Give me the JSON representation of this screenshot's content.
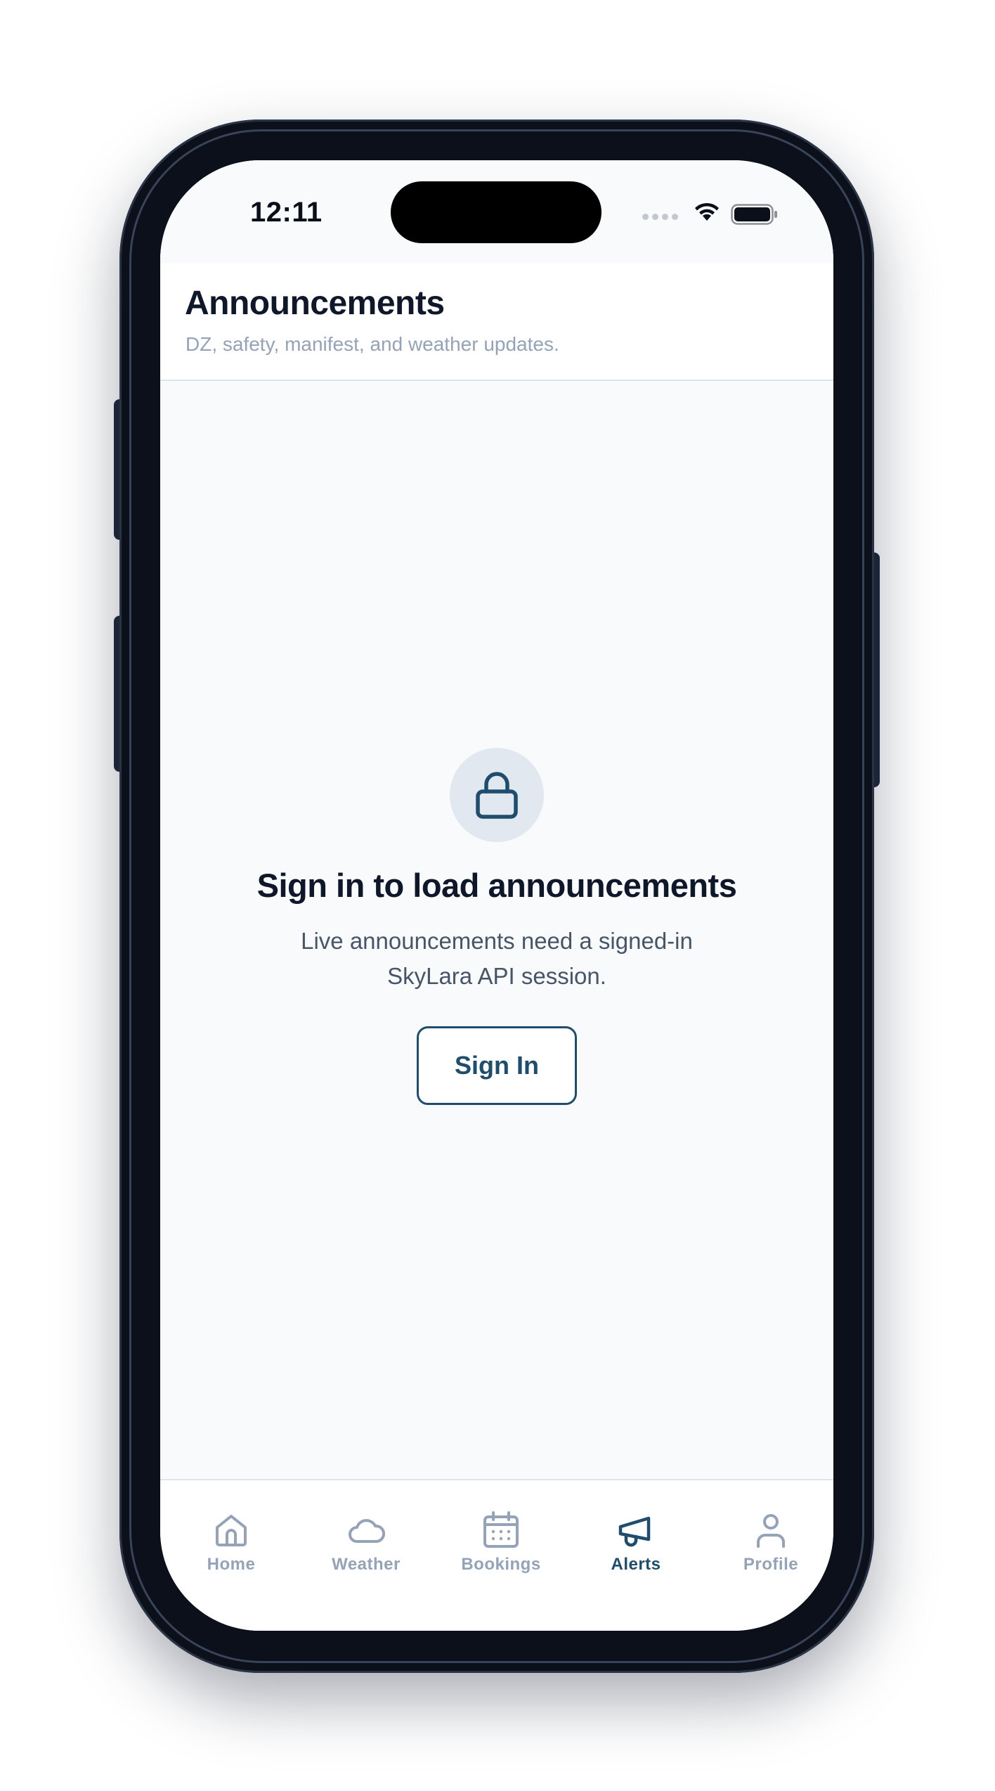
{
  "status_bar": {
    "time": "12:11"
  },
  "header": {
    "title": "Announcements",
    "subtitle": "DZ, safety, manifest, and weather updates."
  },
  "empty_state": {
    "icon": "lock-icon",
    "title": "Sign in to load announcements",
    "description": "Live announcements need a signed-in SkyLara API session.",
    "button_label": "Sign In"
  },
  "tab_bar": {
    "active": "Alerts",
    "tabs": [
      {
        "label": "Home",
        "icon": "home-icon"
      },
      {
        "label": "Weather",
        "icon": "cloud-icon"
      },
      {
        "label": "Bookings",
        "icon": "calendar-icon"
      },
      {
        "label": "Alerts",
        "icon": "megaphone-icon"
      },
      {
        "label": "Profile",
        "icon": "person-icon"
      }
    ]
  },
  "colors": {
    "accent": "#1e4d6e",
    "inactive": "#94a3b8",
    "title": "#0f172a",
    "background": "#f8fafc"
  }
}
